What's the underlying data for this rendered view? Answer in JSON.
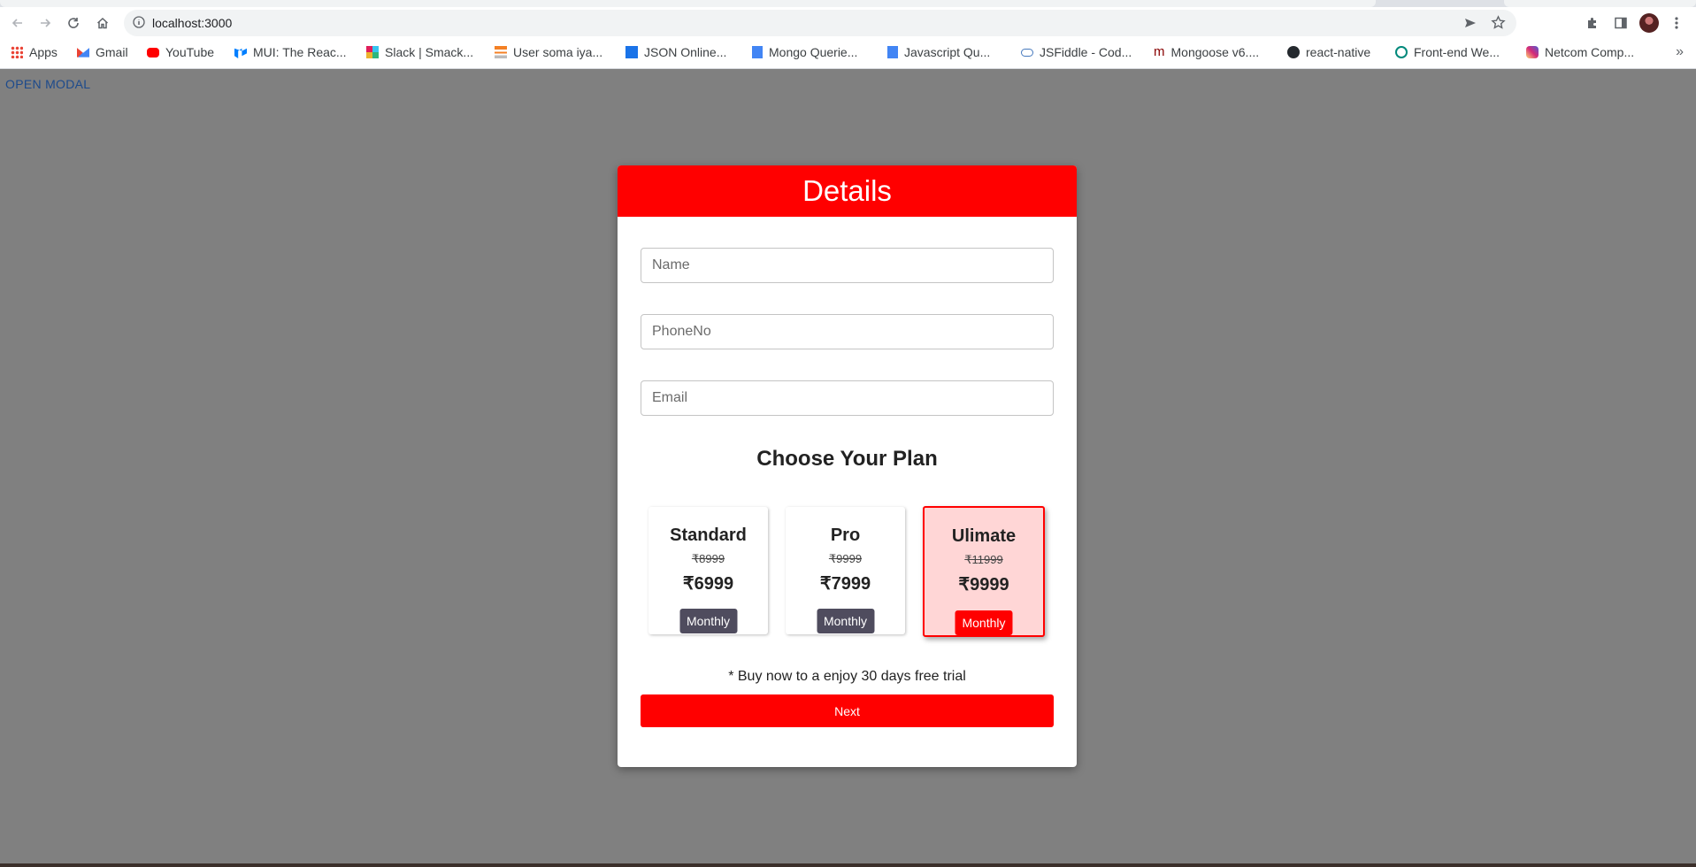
{
  "browser": {
    "url": "localhost:3000",
    "bookmarks": [
      {
        "label": "Apps",
        "icon": "apps-grid-icon"
      },
      {
        "label": "Gmail",
        "icon": "gmail-icon"
      },
      {
        "label": "YouTube",
        "icon": "youtube-icon"
      },
      {
        "label": "MUI: The Reac...",
        "icon": "mui-icon"
      },
      {
        "label": "Slack | Smack...",
        "icon": "slack-icon"
      },
      {
        "label": "User soma iya...",
        "icon": "stackoverflow-icon"
      },
      {
        "label": "JSON Online...",
        "icon": "json-icon"
      },
      {
        "label": "Mongo Querie...",
        "icon": "docs-icon"
      },
      {
        "label": "Javascript Qu...",
        "icon": "docs-icon"
      },
      {
        "label": "JSFiddle - Cod...",
        "icon": "jsfiddle-icon"
      },
      {
        "label": "Mongoose v6....",
        "icon": "mongoose-icon"
      },
      {
        "label": "react-native",
        "icon": "github-icon"
      },
      {
        "label": "Front-end We...",
        "icon": "frontend-icon"
      },
      {
        "label": "Netcom Comp...",
        "icon": "instagram-icon"
      }
    ],
    "more": "»"
  },
  "page": {
    "open_modal_label": "OPEN MODAL",
    "backdrop_color": "#808080"
  },
  "modal": {
    "title": "Details",
    "accent_color": "#ff0000",
    "fields": {
      "name_placeholder": "Name",
      "phone_placeholder": "PhoneNo",
      "email_placeholder": "Email"
    },
    "plans_title": "Choose Your Plan",
    "plans": [
      {
        "name": "Standard",
        "old_price": "₹8999",
        "price": "₹6999",
        "cycle": "Monthly",
        "selected": false
      },
      {
        "name": "Pro",
        "old_price": "₹9999",
        "price": "₹7999",
        "cycle": "Monthly",
        "selected": false
      },
      {
        "name": "Ulimate",
        "old_price": "₹11999",
        "price": "₹9999",
        "cycle": "Monthly",
        "selected": true
      }
    ],
    "trial_note": "* Buy now to a enjoy 30 days free trial",
    "next_label": "Next"
  }
}
